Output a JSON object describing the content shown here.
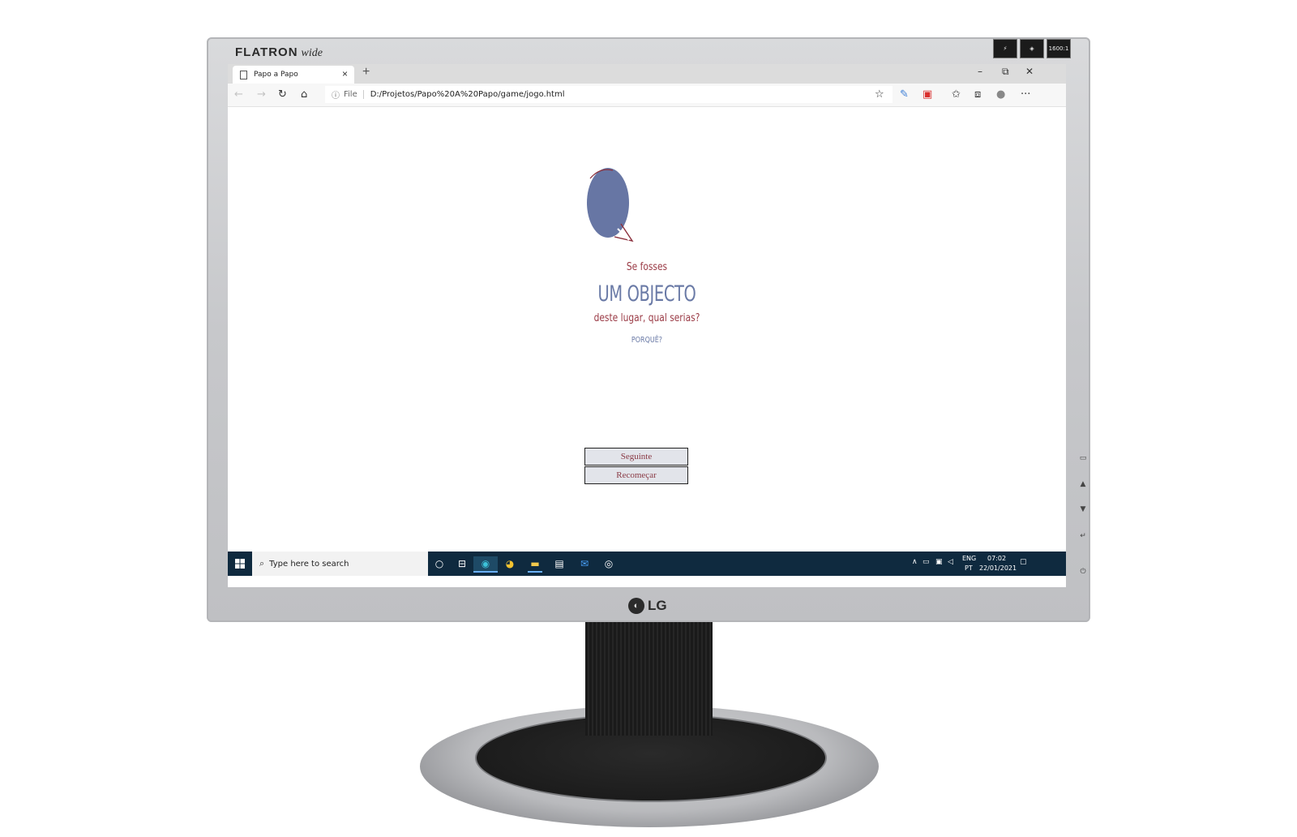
{
  "monitor": {
    "brand_left": "FLATRON",
    "brand_script": "wide",
    "logo_letters": "LG",
    "badge_text": "1600:1"
  },
  "browser": {
    "tab_title": "Papo a Papo",
    "scheme_label": "File",
    "url": "D:/Projetos/Papo%20A%20Papo/game/jogo.html"
  },
  "page": {
    "line1": "Se fosses",
    "line2": "UM OBJECTO",
    "line3": "deste lugar, qual serias?",
    "line4": "PORQUÊ?",
    "next_button": "Seguinte",
    "restart_button": "Recomeçar"
  },
  "taskbar": {
    "search_placeholder": "Type here to search",
    "lang_top": "ENG",
    "lang_bottom": "PT",
    "time": "07:02",
    "date": "22/01/2021"
  },
  "colors": {
    "accent_red": "#9a3a45",
    "accent_blue": "#6a7aa6",
    "taskbar": "#0f2a3f"
  }
}
